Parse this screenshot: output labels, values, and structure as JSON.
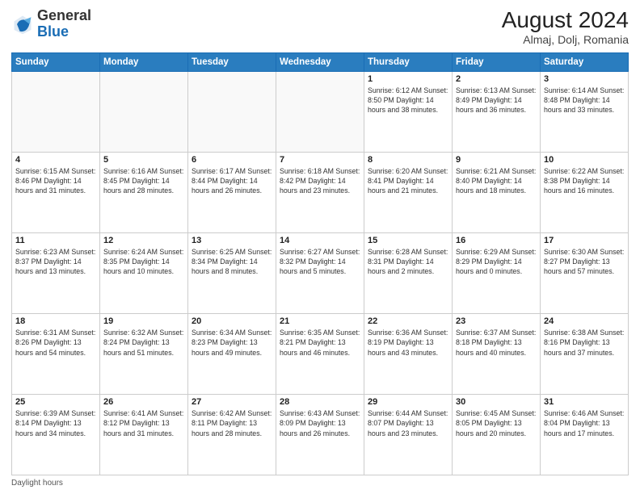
{
  "header": {
    "logo_general": "General",
    "logo_blue": "Blue",
    "month_year": "August 2024",
    "location": "Almaj, Dolj, Romania"
  },
  "days_of_week": [
    "Sunday",
    "Monday",
    "Tuesday",
    "Wednesday",
    "Thursday",
    "Friday",
    "Saturday"
  ],
  "footer": {
    "daylight_label": "Daylight hours"
  },
  "weeks": [
    [
      {
        "day": "",
        "info": ""
      },
      {
        "day": "",
        "info": ""
      },
      {
        "day": "",
        "info": ""
      },
      {
        "day": "",
        "info": ""
      },
      {
        "day": "1",
        "info": "Sunrise: 6:12 AM\nSunset: 8:50 PM\nDaylight: 14 hours\nand 38 minutes."
      },
      {
        "day": "2",
        "info": "Sunrise: 6:13 AM\nSunset: 8:49 PM\nDaylight: 14 hours\nand 36 minutes."
      },
      {
        "day": "3",
        "info": "Sunrise: 6:14 AM\nSunset: 8:48 PM\nDaylight: 14 hours\nand 33 minutes."
      }
    ],
    [
      {
        "day": "4",
        "info": "Sunrise: 6:15 AM\nSunset: 8:46 PM\nDaylight: 14 hours\nand 31 minutes."
      },
      {
        "day": "5",
        "info": "Sunrise: 6:16 AM\nSunset: 8:45 PM\nDaylight: 14 hours\nand 28 minutes."
      },
      {
        "day": "6",
        "info": "Sunrise: 6:17 AM\nSunset: 8:44 PM\nDaylight: 14 hours\nand 26 minutes."
      },
      {
        "day": "7",
        "info": "Sunrise: 6:18 AM\nSunset: 8:42 PM\nDaylight: 14 hours\nand 23 minutes."
      },
      {
        "day": "8",
        "info": "Sunrise: 6:20 AM\nSunset: 8:41 PM\nDaylight: 14 hours\nand 21 minutes."
      },
      {
        "day": "9",
        "info": "Sunrise: 6:21 AM\nSunset: 8:40 PM\nDaylight: 14 hours\nand 18 minutes."
      },
      {
        "day": "10",
        "info": "Sunrise: 6:22 AM\nSunset: 8:38 PM\nDaylight: 14 hours\nand 16 minutes."
      }
    ],
    [
      {
        "day": "11",
        "info": "Sunrise: 6:23 AM\nSunset: 8:37 PM\nDaylight: 14 hours\nand 13 minutes."
      },
      {
        "day": "12",
        "info": "Sunrise: 6:24 AM\nSunset: 8:35 PM\nDaylight: 14 hours\nand 10 minutes."
      },
      {
        "day": "13",
        "info": "Sunrise: 6:25 AM\nSunset: 8:34 PM\nDaylight: 14 hours\nand 8 minutes."
      },
      {
        "day": "14",
        "info": "Sunrise: 6:27 AM\nSunset: 8:32 PM\nDaylight: 14 hours\nand 5 minutes."
      },
      {
        "day": "15",
        "info": "Sunrise: 6:28 AM\nSunset: 8:31 PM\nDaylight: 14 hours\nand 2 minutes."
      },
      {
        "day": "16",
        "info": "Sunrise: 6:29 AM\nSunset: 8:29 PM\nDaylight: 14 hours\nand 0 minutes."
      },
      {
        "day": "17",
        "info": "Sunrise: 6:30 AM\nSunset: 8:27 PM\nDaylight: 13 hours\nand 57 minutes."
      }
    ],
    [
      {
        "day": "18",
        "info": "Sunrise: 6:31 AM\nSunset: 8:26 PM\nDaylight: 13 hours\nand 54 minutes."
      },
      {
        "day": "19",
        "info": "Sunrise: 6:32 AM\nSunset: 8:24 PM\nDaylight: 13 hours\nand 51 minutes."
      },
      {
        "day": "20",
        "info": "Sunrise: 6:34 AM\nSunset: 8:23 PM\nDaylight: 13 hours\nand 49 minutes."
      },
      {
        "day": "21",
        "info": "Sunrise: 6:35 AM\nSunset: 8:21 PM\nDaylight: 13 hours\nand 46 minutes."
      },
      {
        "day": "22",
        "info": "Sunrise: 6:36 AM\nSunset: 8:19 PM\nDaylight: 13 hours\nand 43 minutes."
      },
      {
        "day": "23",
        "info": "Sunrise: 6:37 AM\nSunset: 8:18 PM\nDaylight: 13 hours\nand 40 minutes."
      },
      {
        "day": "24",
        "info": "Sunrise: 6:38 AM\nSunset: 8:16 PM\nDaylight: 13 hours\nand 37 minutes."
      }
    ],
    [
      {
        "day": "25",
        "info": "Sunrise: 6:39 AM\nSunset: 8:14 PM\nDaylight: 13 hours\nand 34 minutes."
      },
      {
        "day": "26",
        "info": "Sunrise: 6:41 AM\nSunset: 8:12 PM\nDaylight: 13 hours\nand 31 minutes."
      },
      {
        "day": "27",
        "info": "Sunrise: 6:42 AM\nSunset: 8:11 PM\nDaylight: 13 hours\nand 28 minutes."
      },
      {
        "day": "28",
        "info": "Sunrise: 6:43 AM\nSunset: 8:09 PM\nDaylight: 13 hours\nand 26 minutes."
      },
      {
        "day": "29",
        "info": "Sunrise: 6:44 AM\nSunset: 8:07 PM\nDaylight: 13 hours\nand 23 minutes."
      },
      {
        "day": "30",
        "info": "Sunrise: 6:45 AM\nSunset: 8:05 PM\nDaylight: 13 hours\nand 20 minutes."
      },
      {
        "day": "31",
        "info": "Sunrise: 6:46 AM\nSunset: 8:04 PM\nDaylight: 13 hours\nand 17 minutes."
      }
    ]
  ]
}
